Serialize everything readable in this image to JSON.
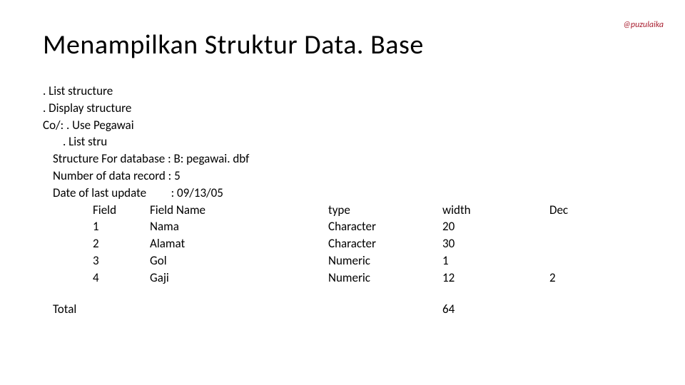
{
  "watermark": "@puzulaika",
  "title": "Menampilkan Struktur Data. Base",
  "lines": {
    "l0": ". List structure",
    "l1": ". Display structure",
    "l2": "Co/: . Use Pegawai",
    "l3": ". List stru",
    "l4": "Structure For database : B: pegawai. dbf",
    "l5": "Number of data record : 5",
    "l6": "Date of last update         : 09/13/05"
  },
  "headers": {
    "field": "Field",
    "fieldname": "Field Name",
    "type": "type",
    "width": "width",
    "dec": "Dec"
  },
  "rows": [
    {
      "num": "1",
      "name": "Nama",
      "type": "Character",
      "width": "20",
      "dec": ""
    },
    {
      "num": "2",
      "name": "Alamat",
      "type": "Character",
      "width": "30",
      "dec": ""
    },
    {
      "num": "3",
      "name": "Gol",
      "type": "Numeric",
      "width": "1",
      "dec": ""
    },
    {
      "num": "4",
      "name": "Gaji",
      "type": "Numeric",
      "width": "12",
      "dec": "2"
    }
  ],
  "total": {
    "label": "Total",
    "value": "64"
  },
  "chart_data": {
    "type": "table",
    "title": "Structure For database B: pegawai.dbf",
    "columns": [
      "Field",
      "Field Name",
      "type",
      "width",
      "Dec"
    ],
    "rows": [
      [
        1,
        "Nama",
        "Character",
        20,
        null
      ],
      [
        2,
        "Alamat",
        "Character",
        30,
        null
      ],
      [
        3,
        "Gol",
        "Numeric",
        1,
        null
      ],
      [
        4,
        "Gaji",
        "Numeric",
        12,
        2
      ]
    ],
    "total_width": 64,
    "record_count": 5,
    "last_update": "09/13/05"
  }
}
